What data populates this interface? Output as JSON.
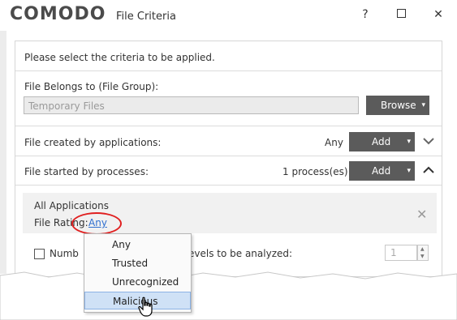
{
  "window": {
    "brand": "COMODO",
    "title": "File Criteria",
    "controls": {
      "help": "?",
      "maximize": "",
      "close": "✕"
    }
  },
  "intro_text": "Please select the criteria to be applied.",
  "file_group": {
    "label": "File Belongs to (File Group):",
    "value": "Temporary Files",
    "browse_label": "Browse"
  },
  "created_by": {
    "label": "File created by applications:",
    "value": "Any",
    "add_label": "Add"
  },
  "started_by": {
    "label": "File started by processes:",
    "value": "1 process(es)",
    "add_label": "Add"
  },
  "process_entry": {
    "name": "All Applications",
    "rating_label": "File Rating:",
    "rating_value": "Any"
  },
  "levels": {
    "label_part1": "Numb",
    "label_part2": "evels to be analyzed:",
    "value": "1"
  },
  "rating_dropdown": {
    "options": [
      "Any",
      "Trusted",
      "Unrecognized",
      "Malicious"
    ],
    "hovered": "Malicious"
  },
  "icons": {
    "dropdown_caret": "▾",
    "chevron_down": "⌵",
    "chevron_up": "⌃",
    "remove": "✕"
  }
}
